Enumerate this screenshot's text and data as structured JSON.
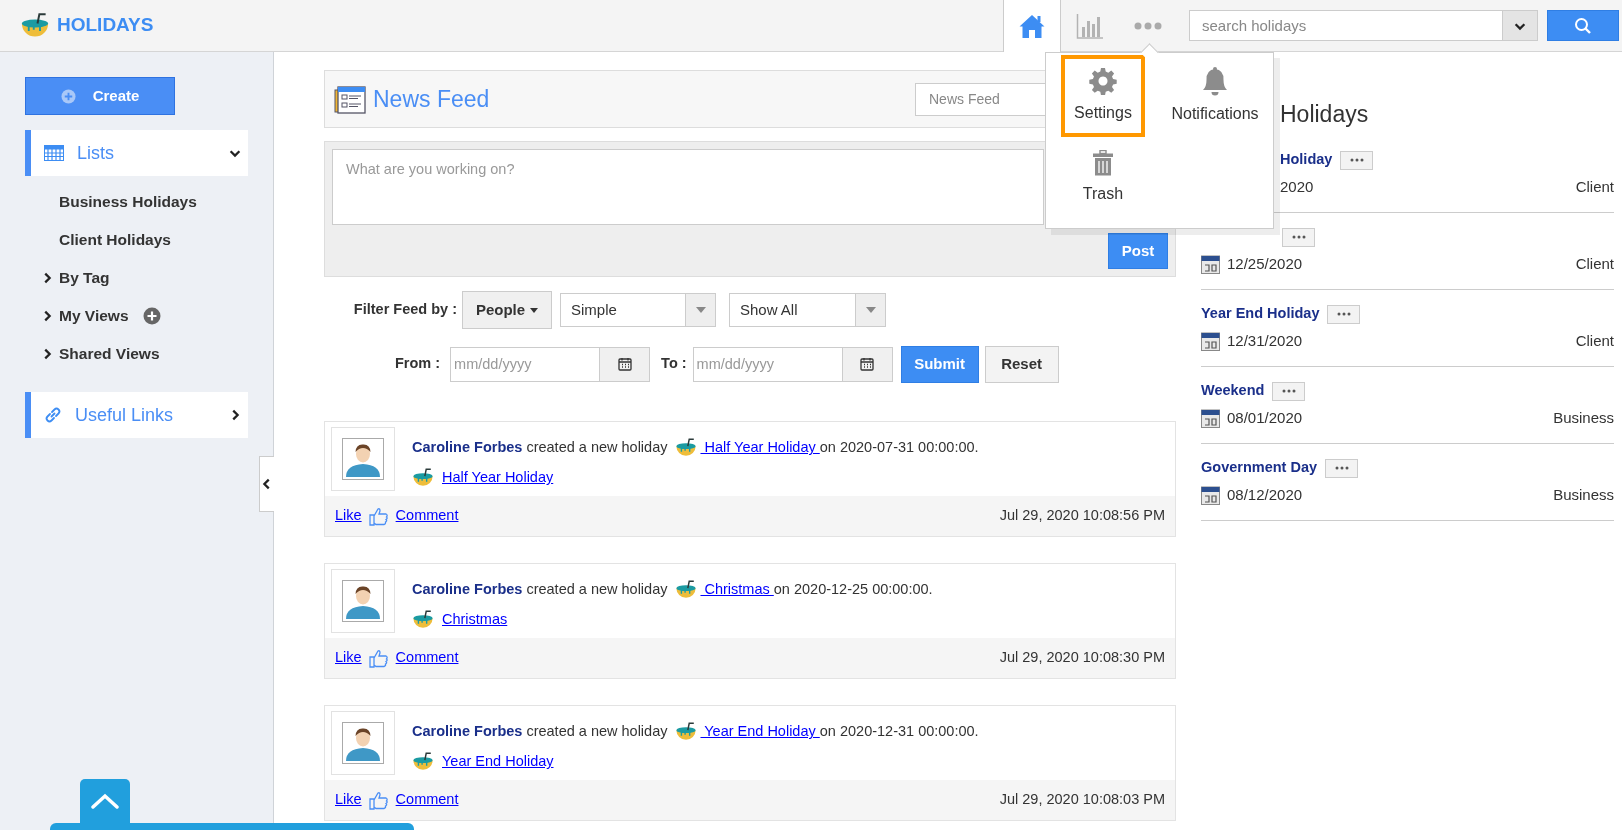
{
  "header": {
    "app_title": "HOLIDAYS",
    "nav": [
      {
        "kind": "home",
        "selected": true
      },
      {
        "kind": "chart",
        "selected": false
      },
      {
        "kind": "more",
        "selected": false
      }
    ],
    "search": {
      "placeholder": "search holidays"
    }
  },
  "more_menu": {
    "items": [
      {
        "label": "Settings",
        "selected": true
      },
      {
        "label": "Notifications",
        "selected": false
      },
      {
        "label": "Trash",
        "selected": false
      }
    ]
  },
  "sidebar": {
    "create_label": "Create",
    "sections": [
      {
        "label": "Lists",
        "expanded": true,
        "children": [
          {
            "label": "Business Holidays",
            "kind": "link"
          },
          {
            "label": "Client Holidays",
            "kind": "link"
          },
          {
            "label": "By Tag",
            "kind": "group",
            "expanded": false,
            "addable": false
          },
          {
            "label": "My Views",
            "kind": "group",
            "expanded": false,
            "addable": true
          },
          {
            "label": "Shared Views",
            "kind": "group",
            "expanded": false,
            "addable": false
          }
        ]
      },
      {
        "label": "Useful Links",
        "expanded": false
      }
    ]
  },
  "feed": {
    "title": "News Feed",
    "view_select": "News Feed",
    "composer": {
      "placeholder": "What are you working on?",
      "post_button": "Post"
    },
    "filter": {
      "label": "Filter Feed by :",
      "people_button": "People",
      "selects": [
        "Simple",
        "Show All"
      ],
      "from_label": "From :",
      "to_label": "To :",
      "from_placeholder": "mm/dd/yyyy",
      "to_placeholder": "mm/dd/yyyy",
      "submit": "Submit",
      "reset": "Reset"
    },
    "posts": [
      {
        "author": "Caroline Forbes",
        "action": "created a new holiday",
        "link": "Half Year Holiday",
        "suffix": "on 2020-07-31 00:00:00.",
        "holiday": "Half Year Holiday",
        "like": "Like",
        "comment": "Comment",
        "time": "Jul 29, 2020 10:08:56 PM"
      },
      {
        "author": "Caroline Forbes",
        "action": "created a new holiday",
        "link": "Christmas",
        "suffix": "on 2020-12-25 00:00:00.",
        "holiday": "Christmas",
        "like": "Like",
        "comment": "Comment",
        "time": "Jul 29, 2020 10:08:30 PM"
      },
      {
        "author": "Caroline Forbes",
        "action": "created a new holiday",
        "link": "Year End Holiday",
        "suffix": "on 2020-12-31 00:00:00.",
        "holiday": "Year End Holiday",
        "like": "Like",
        "comment": "Comment",
        "time": "Jul 29, 2020 10:08:03 PM"
      }
    ]
  },
  "holidays_panel": {
    "title": "Holidays",
    "items": [
      {
        "cut": true,
        "name": "Holiday",
        "date": "2020",
        "type": "Client"
      },
      {
        "cut": true,
        "date": "12/25/2020",
        "type": "Client"
      },
      {
        "cut": false,
        "name": "Year End Holiday",
        "date": "12/31/2020",
        "type": "Client"
      },
      {
        "cut": false,
        "name": "Weekend",
        "date": "08/01/2020",
        "type": "Business"
      },
      {
        "cut": false,
        "name": "Government Day",
        "date": "08/12/2020",
        "type": "Business"
      }
    ]
  }
}
